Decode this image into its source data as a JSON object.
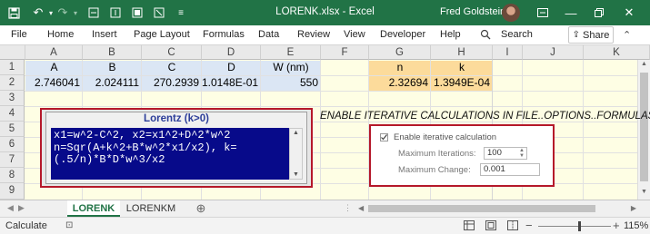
{
  "titlebar": {
    "doc_title": "LORENK.xlsx  -  Excel",
    "user_name": "Fred Goldstein",
    "icons": [
      "save-icon",
      "undo-icon",
      "redo-icon",
      "quick-access-icon-1",
      "quick-access-icon-2",
      "quick-access-icon-3",
      "quick-access-icon-4",
      "customize-dropdown-icon"
    ]
  },
  "ribbon": {
    "tabs": [
      "File",
      "Home",
      "Insert",
      "Page Layout",
      "Formulas",
      "Data",
      "Review",
      "View",
      "Developer",
      "Help"
    ],
    "search": "Search",
    "share": "Share"
  },
  "grid": {
    "columns": [
      "A",
      "B",
      "C",
      "D",
      "E",
      "F",
      "G",
      "H",
      "I",
      "J",
      "K"
    ],
    "rows": [
      "1",
      "2",
      "3",
      "4",
      "5",
      "6",
      "7",
      "8",
      "9"
    ],
    "row1": {
      "A": "A",
      "B": "B",
      "C": "C",
      "D": "D",
      "E": "W (nm)",
      "G": "n",
      "H": "k"
    },
    "row2": {
      "A": "2.746041",
      "B": "2.024111",
      "C": "270.2939",
      "D": "1.0148E-01",
      "E": "550",
      "G": "2.32694",
      "H": "1.3949E-04"
    },
    "input_fill": "#dbe6f4",
    "output_fill": "#fcdb9b",
    "sheet_fill": "#fefee4"
  },
  "lorentz": {
    "title": "Lorentz (k>0)",
    "lines": [
      "x1=w^2-C^2, x2=x1^2+D^2*w^2",
      "n=Sqr(A+k^2+B*w^2*x1/x2), k=",
      "(.5/n)*B*D*w^3/x2"
    ]
  },
  "note": "ENABLE ITERATIVE CALCULATIONS IN FILE..OPTIONS..FORMULAS",
  "iterative": {
    "enable_label": "Enable iterative calculation",
    "enabled": true,
    "max_iter_label": "Maximum Iterations:",
    "max_iter_value": "100",
    "max_change_label": "Maximum Change:",
    "max_change_value": "0.001"
  },
  "sheets": {
    "tabs": [
      "LORENK",
      "LORENKM"
    ],
    "active": 0
  },
  "status": {
    "mode": "Calculate",
    "zoom": "115%"
  }
}
